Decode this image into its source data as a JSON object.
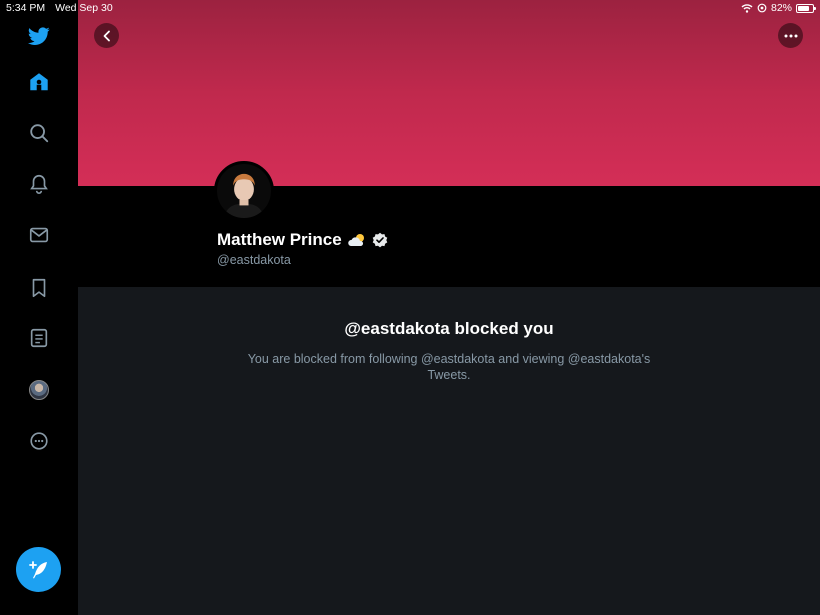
{
  "status_bar": {
    "time": "5:34 PM",
    "date": "Wed Sep 30",
    "battery": "82%",
    "battery_level": 0.82
  },
  "sidebar": {
    "items": [
      {
        "icon": "twitter-logo-icon"
      },
      {
        "icon": "home-icon",
        "active": true
      },
      {
        "icon": "search-icon"
      },
      {
        "icon": "bell-icon"
      },
      {
        "icon": "mail-icon"
      },
      {
        "icon": "bookmark-icon"
      },
      {
        "icon": "list-icon"
      },
      {
        "icon": "avatar"
      },
      {
        "icon": "more-circle-icon"
      }
    ],
    "compose_icon": "compose-feather-icon"
  },
  "profile": {
    "display_name": "Matthew Prince",
    "name_emoji_icon": "sun-behind-cloud-icon",
    "verified_icon": "verified-badge-icon",
    "handle": "@eastdakota"
  },
  "blocked": {
    "title": "@eastdakota blocked you",
    "description": "You are blocked from following @eastdakota and viewing @eastdakota's Tweets."
  },
  "colors": {
    "accent": "#1da1f2",
    "banner": "#d42e57",
    "background": "#15181c",
    "muted": "#8899a6"
  }
}
